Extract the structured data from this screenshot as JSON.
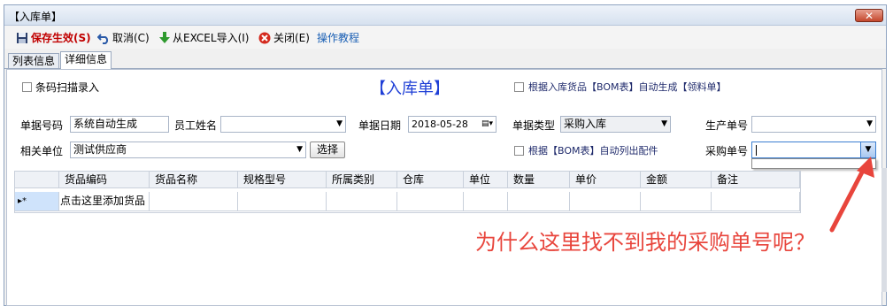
{
  "window": {
    "title": "【入库单】",
    "close_glyph": "✕"
  },
  "toolbar": {
    "save": "保存生效(S)",
    "cancel": "取消(C)",
    "import": "从EXCEL导入(I)",
    "close": "关闭(E)",
    "tutorial": "操作教程"
  },
  "tabs": [
    {
      "label": "列表信息"
    },
    {
      "label": "详细信息"
    }
  ],
  "form": {
    "scan_label": "条码扫描录入",
    "heading": "【入库单】",
    "bom_auto_label": "根据入库货品【BOM表】自动生成【领料单】",
    "doc_no_label": "单据号码",
    "doc_no_value": "系统自动生成",
    "employee_label": "员工姓名",
    "employee_value": "",
    "date_label": "单据日期",
    "date_value": "2018-05-28",
    "doc_type_label": "单据类型",
    "doc_type_value": "采购入库",
    "prod_no_label": "生产单号",
    "prod_no_value": "",
    "related_label": "相关单位",
    "related_value": "测试供应商",
    "select_button": "选择",
    "bom_list_label": "根据【BOM表】自动列出配件",
    "purchase_no_label": "采购单号",
    "purchase_no_value": ""
  },
  "grid": {
    "columns": [
      "货品编码",
      "货品名称",
      "规格型号",
      "所属类别",
      "仓库",
      "单位",
      "数量",
      "单价",
      "金额",
      "备注"
    ],
    "row_indicator": "▸*",
    "new_row_text": "点击这里添加货品"
  },
  "annotation": "为什么这里找不到我的采购单号呢？",
  "colors": {
    "accent_red": "#c00000",
    "link_blue": "#1a5fb4",
    "annotation": "#e8453c",
    "heading_blue": "#1f3fd6"
  }
}
